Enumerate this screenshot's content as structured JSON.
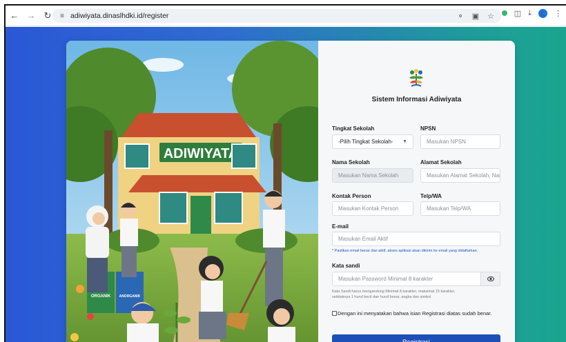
{
  "browser": {
    "url": "adiwiyata.dinaslhdki.id/register",
    "avatar_letter": "L"
  },
  "illustration": {
    "sign_text": "ADIWIYATA",
    "bin_label_organic": "ORGANIK",
    "bin_label_anorganic": "ANORGANIK"
  },
  "form": {
    "title": "Sistem Informasi Adiwiyata",
    "tingkat_label": "Tingkat Sekolah",
    "tingkat_value": "-Pilih Tingkat Sekolah-",
    "npsn_label": "NPSN",
    "npsn_placeholder": "Masukan NPSN",
    "nama_label": "Nama Sekolah",
    "nama_placeholder": "Masukan Nama Sekolah",
    "alamat_label": "Alamat Sekolah",
    "alamat_placeholder": "Masukan Alamat Sekolah, Nama Jalan",
    "kontak_label": "Kontak Person",
    "kontak_placeholder": "Masukan Kontak Person",
    "telp_label": "Telp/WA",
    "telp_placeholder": "Masukan Telp/WA",
    "email_label": "E-mail",
    "email_placeholder": "Masukan Email Aktif",
    "email_hint": "* Pastikan email benar dan aktif, akses aplikasi akan dikirim ke email yang didaftarkan.",
    "password_label": "Kata sandi",
    "password_placeholder": "Masukan Password Minimal 8 karakter",
    "password_hint_1": "Kata Sandi harus mengandung Minimal 8 karakter, maksimal 15 karakter,",
    "password_hint_2": "setidaknya 1 huruf kecil dan huruf besar, angka dan simbol",
    "agree_label": "Dengan ini menyatakan bahwa isian Registrasi diatas sudah benar.",
    "submit_label": "Registrasi"
  },
  "colors": {
    "accent": "#1d4fb8",
    "bg_left": "#2a57d6",
    "bg_right": "#1aa58f"
  }
}
